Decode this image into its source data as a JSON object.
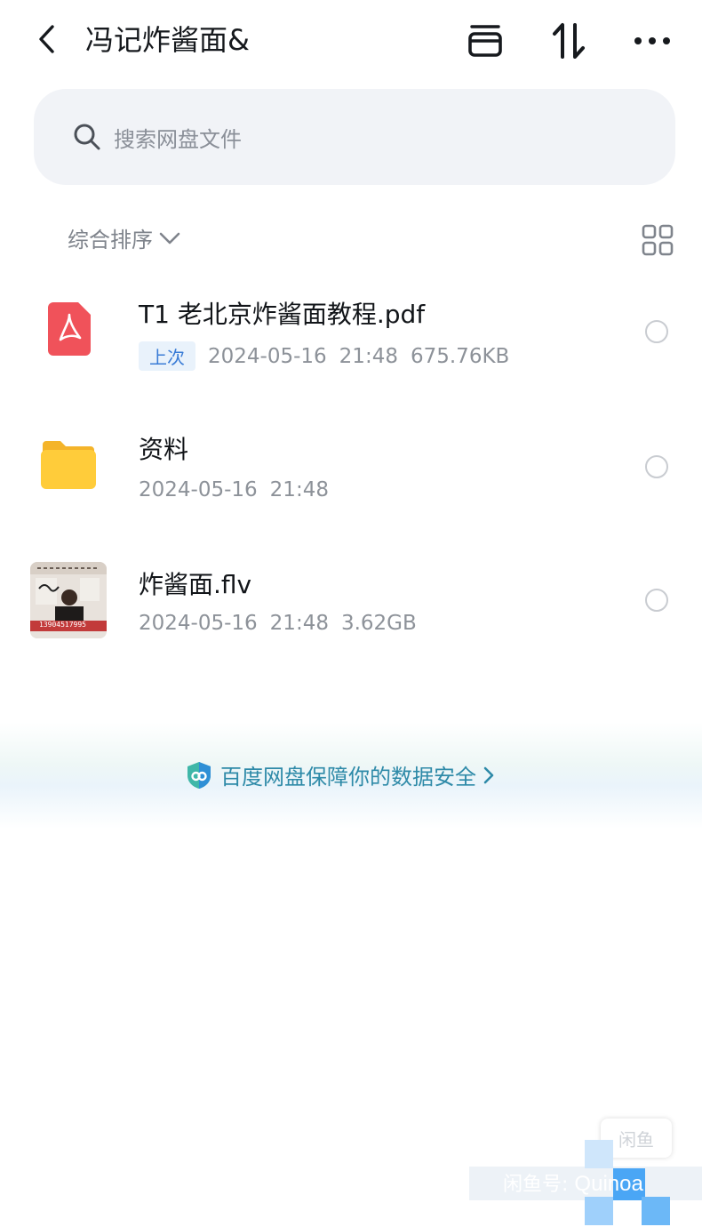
{
  "header": {
    "title": "冯记炸酱面&",
    "icons": [
      "back-icon",
      "archive-icon",
      "sort-arrows-icon",
      "more-icon"
    ]
  },
  "search": {
    "placeholder": "搜索网盘文件"
  },
  "sort": {
    "label": "综合排序"
  },
  "files": [
    {
      "name": "T1 老北京炸酱面教程.pdf",
      "tag": "上次",
      "date": "2024-05-16",
      "time": "21:48",
      "size": "675.76KB",
      "icon": "pdf-icon"
    },
    {
      "name": "资料",
      "date": "2024-05-16",
      "time": "21:48",
      "icon": "folder-icon"
    },
    {
      "name": "炸酱面.flv",
      "date": "2024-05-16",
      "time": "21:48",
      "size": "3.62GB",
      "icon": "video-thumbnail",
      "thumb_text": "13904517995"
    }
  ],
  "banner": {
    "text": "百度网盘保障你的数据安全"
  },
  "watermark": {
    "badge": "闲鱼",
    "prefix": "闲鱼号:",
    "name": "Quinoa"
  },
  "colors": {
    "pdf_red": "#f0525a",
    "folder_yellow": "#ffcc3a",
    "accent_blue": "#3a7cd6",
    "banner_teal": "#2e8aa8"
  }
}
